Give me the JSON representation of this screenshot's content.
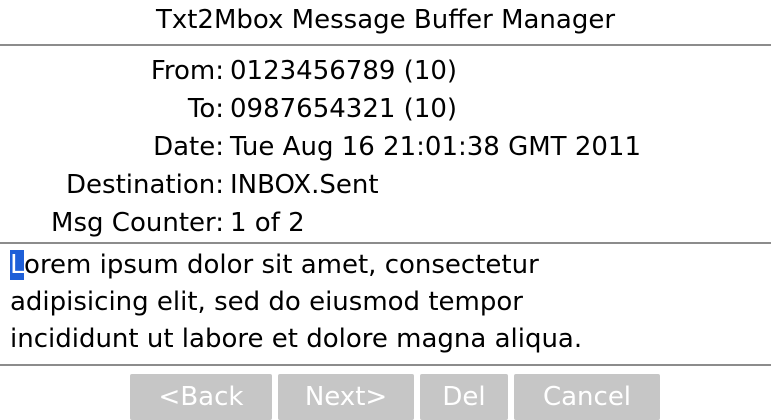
{
  "app": {
    "title": "Txt2Mbox Message Buffer Manager"
  },
  "header": {
    "from_label": "From:",
    "from_value": "0123456789 (10)",
    "to_label": "To:",
    "to_value": "0987654321 (10)",
    "date_label": "Date:",
    "date_value": "Tue Aug 16 21:01:38 GMT 2011",
    "destination_label": "Destination:",
    "destination_value": "INBOX.Sent",
    "counter_label": "Msg Counter:",
    "counter_value": "1 of 2"
  },
  "message": {
    "cursor_char": "L",
    "line1_rest": "orem ipsum dolor sit amet, consectetur",
    "line2": "adipisicing elit, sed do eiusmod tempor",
    "line3": "incididunt ut labore et dolore magna aliqua."
  },
  "buttons": {
    "back_label": "<Back",
    "next_label": "Next>",
    "del_label": "Del",
    "cancel_label": "Cancel"
  },
  "colors": {
    "cursor": "#1e5fd8",
    "button_bg": "#c6c6c6",
    "separator": "#8c8c8c"
  }
}
